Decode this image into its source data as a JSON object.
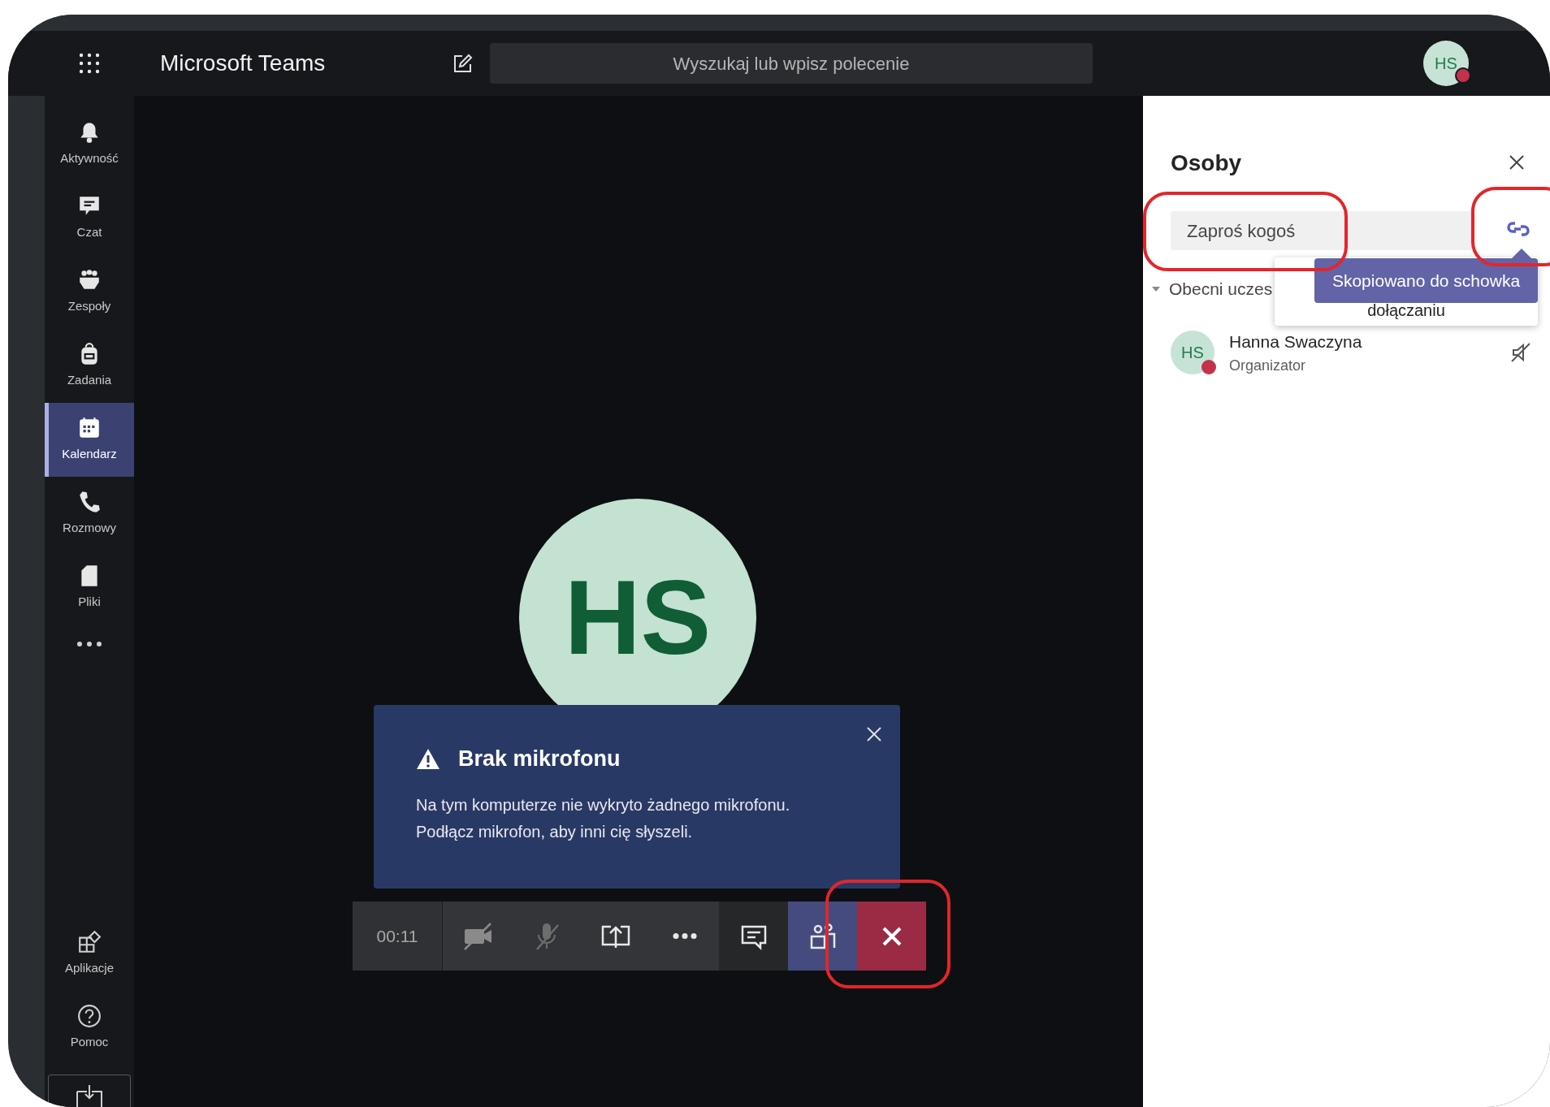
{
  "app": {
    "title": "Microsoft Teams",
    "search_placeholder": "Wyszukaj lub wpisz polecenie",
    "user_initials": "HS"
  },
  "rail": {
    "items": [
      {
        "kind": "bell",
        "label": "Aktywność",
        "selected": false
      },
      {
        "kind": "chat",
        "label": "Czat",
        "selected": false
      },
      {
        "kind": "teams",
        "label": "Zespoły",
        "selected": false
      },
      {
        "kind": "bag",
        "label": "Zadania",
        "selected": false
      },
      {
        "kind": "calendar",
        "label": "Kalendarz",
        "selected": true
      },
      {
        "kind": "phone",
        "label": "Rozmowy",
        "selected": false
      },
      {
        "kind": "file",
        "label": "Pliki",
        "selected": false
      }
    ],
    "bottom_items": [
      {
        "kind": "apps",
        "label": "Aplikacje"
      },
      {
        "kind": "help",
        "label": "Pomoc"
      }
    ]
  },
  "stage": {
    "initials": "HS"
  },
  "notification": {
    "title": "Brak mikrofonu",
    "lines": [
      "Na tym komputerze nie wykryto żadnego mikrofonu.",
      "Podłącz mikrofon, aby inni cię słyszeli."
    ]
  },
  "call_controls": {
    "timer": "00:11",
    "buttons": [
      {
        "kind": "camera-off",
        "selected": false
      },
      {
        "kind": "mic-off",
        "selected": false
      },
      {
        "kind": "share",
        "selected": false
      },
      {
        "kind": "more",
        "selected": false
      },
      {
        "kind": "chat",
        "selected": false
      },
      {
        "kind": "people",
        "selected": true
      },
      {
        "kind": "hangup",
        "selected": false
      }
    ]
  },
  "panel": {
    "title": "Osoby",
    "invite_placeholder": "Zaproś kogoś",
    "tooltip": "Skopiowano do schowka",
    "popup_text": "dołączaniu",
    "section": {
      "label": "Obecni uczes",
      "expanded": true
    },
    "participants": [
      {
        "initials": "HS",
        "name": "Hanna Swaczyna",
        "role": "Organizator"
      }
    ]
  }
}
